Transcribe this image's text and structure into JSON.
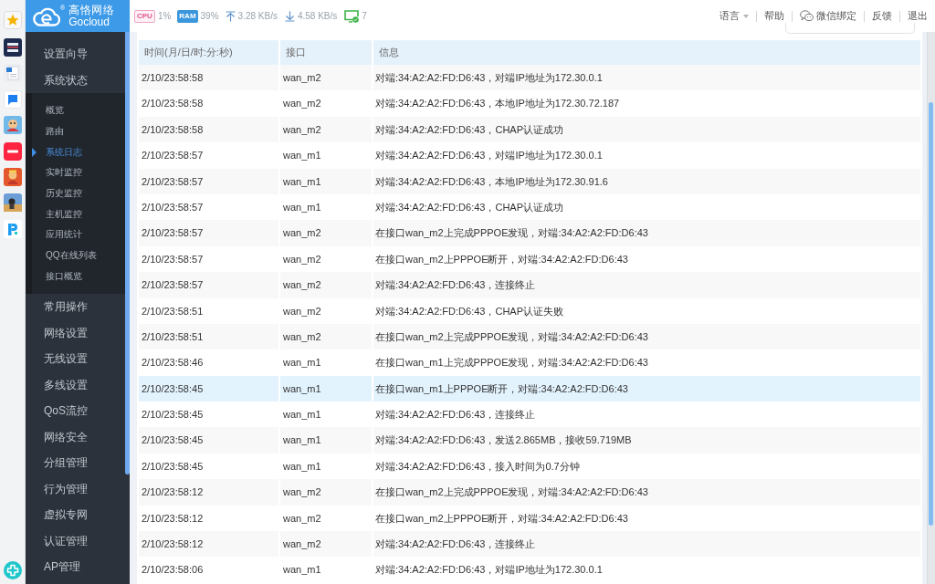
{
  "logo": {
    "title": "高恪网络",
    "subtitle": "Gocloud",
    "mark": "®"
  },
  "status": {
    "cpu": {
      "label": "CPU",
      "usage": "1%"
    },
    "ram": {
      "label": "RAM",
      "usage": "39%"
    },
    "upload": "3.28 KB/s",
    "download": "4.58 KB/s",
    "devices": "7"
  },
  "top_links": [
    {
      "kind": "dropdown",
      "label": "语言"
    },
    {
      "kind": "link",
      "label": "帮助"
    },
    {
      "kind": "wechat",
      "label": "微信绑定"
    },
    {
      "kind": "link",
      "label": "反馈"
    },
    {
      "kind": "link",
      "label": "退出"
    }
  ],
  "sidebar": {
    "items": [
      {
        "label": "设置向导",
        "selected": false
      },
      {
        "label": "系统状态",
        "selected": false,
        "expanded": true,
        "children": [
          {
            "label": "概览",
            "selected": false
          },
          {
            "label": "路由",
            "selected": false
          },
          {
            "label": "系统日志",
            "selected": true
          },
          {
            "label": "实时监控",
            "selected": false
          },
          {
            "label": "历史监控",
            "selected": false
          },
          {
            "label": "主机监控",
            "selected": false
          },
          {
            "label": "应用统计",
            "selected": false
          },
          {
            "label": "QQ在线列表",
            "selected": false
          },
          {
            "label": "接口概览",
            "selected": false
          }
        ]
      },
      {
        "label": "常用操作",
        "selected": false
      },
      {
        "label": "网络设置",
        "selected": false
      },
      {
        "label": "无线设置",
        "selected": false
      },
      {
        "label": "多线设置",
        "selected": false
      },
      {
        "label": "QoS流控",
        "selected": false
      },
      {
        "label": "网络安全",
        "selected": false
      },
      {
        "label": "分组管理",
        "selected": false
      },
      {
        "label": "行为管理",
        "selected": false
      },
      {
        "label": "虚拟专网",
        "selected": false
      },
      {
        "label": "认证管理",
        "selected": false
      },
      {
        "label": "AP管理",
        "selected": false
      }
    ]
  },
  "table": {
    "columns": [
      "时间(月/日/时:分:秒)",
      "接口",
      "信息"
    ],
    "rows": [
      {
        "time": "2/10/23:58:58",
        "interface": "wan_m2",
        "info": "对端:34:A2:A2:FD:D6:43，对端IP地址为172.30.0.1",
        "selected": false
      },
      {
        "time": "2/10/23:58:58",
        "interface": "wan_m2",
        "info": "对端:34:A2:A2:FD:D6:43，本地IP地址为172.30.72.187",
        "selected": false
      },
      {
        "time": "2/10/23:58:58",
        "interface": "wan_m2",
        "info": "对端:34:A2:A2:FD:D6:43，CHAP认证成功",
        "selected": false
      },
      {
        "time": "2/10/23:58:57",
        "interface": "wan_m1",
        "info": "对端:34:A2:A2:FD:D6:43，对端IP地址为172.30.0.1",
        "selected": false
      },
      {
        "time": "2/10/23:58:57",
        "interface": "wan_m1",
        "info": "对端:34:A2:A2:FD:D6:43，本地IP地址为172.30.91.6",
        "selected": false
      },
      {
        "time": "2/10/23:58:57",
        "interface": "wan_m1",
        "info": "对端:34:A2:A2:FD:D6:43，CHAP认证成功",
        "selected": false
      },
      {
        "time": "2/10/23:58:57",
        "interface": "wan_m2",
        "info": "在接口wan_m2上完成PPPOE发现，对端:34:A2:A2:FD:D6:43",
        "selected": false
      },
      {
        "time": "2/10/23:58:57",
        "interface": "wan_m2",
        "info": "在接口wan_m2上PPPOE断开，对端:34:A2:A2:FD:D6:43",
        "selected": false
      },
      {
        "time": "2/10/23:58:57",
        "interface": "wan_m2",
        "info": "对端:34:A2:A2:FD:D6:43，连接终止",
        "selected": false
      },
      {
        "time": "2/10/23:58:51",
        "interface": "wan_m2",
        "info": "对端:34:A2:A2:FD:D6:43，CHAP认证失败",
        "selected": false
      },
      {
        "time": "2/10/23:58:51",
        "interface": "wan_m2",
        "info": "在接口wan_m2上完成PPPOE发现，对端:34:A2:A2:FD:D6:43",
        "selected": false
      },
      {
        "time": "2/10/23:58:46",
        "interface": "wan_m1",
        "info": "在接口wan_m1上完成PPPOE发现，对端:34:A2:A2:FD:D6:43",
        "selected": false
      },
      {
        "time": "2/10/23:58:45",
        "interface": "wan_m1",
        "info": "在接口wan_m1上PPPOE断开，对端:34:A2:A2:FD:D6:43",
        "selected": true
      },
      {
        "time": "2/10/23:58:45",
        "interface": "wan_m1",
        "info": "对端:34:A2:A2:FD:D6:43，连接终止",
        "selected": false
      },
      {
        "time": "2/10/23:58:45",
        "interface": "wan_m1",
        "info": "对端:34:A2:A2:FD:D6:43，发送2.865MB，接收59.719MB",
        "selected": false
      },
      {
        "time": "2/10/23:58:45",
        "interface": "wan_m1",
        "info": "对端:34:A2:A2:FD:D6:43，接入时间为0.7分钟",
        "selected": false
      },
      {
        "time": "2/10/23:58:12",
        "interface": "wan_m2",
        "info": "在接口wan_m2上完成PPPOE发现，对端:34:A2:A2:FD:D6:43",
        "selected": false
      },
      {
        "time": "2/10/23:58:12",
        "interface": "wan_m2",
        "info": "在接口wan_m2上PPPOE断开，对端:34:A2:A2:FD:D6:43",
        "selected": false
      },
      {
        "time": "2/10/23:58:12",
        "interface": "wan_m2",
        "info": "对端:34:A2:A2:FD:D6:43，连接终止",
        "selected": false
      },
      {
        "time": "2/10/23:58:06",
        "interface": "wan_m1",
        "info": "对端:34:A2:A2:FD:D6:43，对端IP地址为172.30.0.1",
        "selected": false
      }
    ]
  }
}
